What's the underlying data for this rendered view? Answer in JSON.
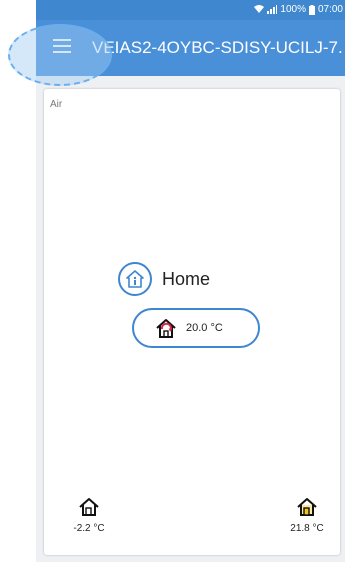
{
  "status_bar": {
    "battery": "100%",
    "time": "07:00"
  },
  "app_bar": {
    "title": "VEIAS2-4OYBC-SDISY-UCILJ-7..."
  },
  "card": {
    "label": "Air",
    "home": {
      "label": "Home",
      "setpoint": "20.0 °C"
    },
    "outdoor": {
      "temperature": "-2.2 °C"
    },
    "indoor": {
      "temperature": "21.8 °C"
    }
  },
  "colors": {
    "app_bar": "#4a90d9",
    "status_bar": "#3f88cf",
    "accent": "#3e86cf",
    "heating": "#d42b4b",
    "indoor_sensor": "#f3c319"
  },
  "icons": {
    "menu": "menu-icon",
    "home_info": "home-info-icon",
    "heating_house": "heating-house-icon",
    "outdoor_house": "outdoor-sensor-house-icon",
    "indoor_house": "indoor-sensor-house-icon"
  }
}
